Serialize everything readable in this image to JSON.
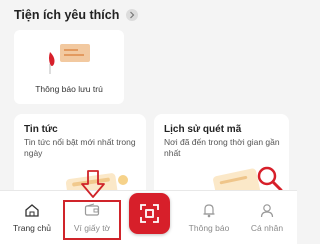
{
  "favorites": {
    "title": "Tiện ích yêu thích",
    "items": [
      {
        "label": "Thông báo lưu trú",
        "icon": "notice-board-icon"
      }
    ]
  },
  "tiles": [
    {
      "title": "Tin tức",
      "description": "Tin tức nổi bật mới nhất trong ngày",
      "icon": "news-icon"
    },
    {
      "title": "Lịch sử quét mã",
      "description": "Nơi đã đến trong thời gian gần nhất",
      "icon": "scan-history-icon"
    }
  ],
  "bottom_nav": {
    "items": [
      {
        "label": "Trang chủ",
        "icon": "home-icon",
        "active": true
      },
      {
        "label": "Ví giấy tờ",
        "icon": "wallet-icon",
        "highlighted": true
      },
      {
        "label": "",
        "icon": "qr-scan-icon"
      },
      {
        "label": "Thông báo",
        "icon": "bell-icon"
      },
      {
        "label": "Cá nhân",
        "icon": "user-icon"
      }
    ]
  },
  "colors": {
    "accent": "#d71f2a",
    "highlight_box": "#d0242a",
    "background": "#f4f4f4"
  }
}
